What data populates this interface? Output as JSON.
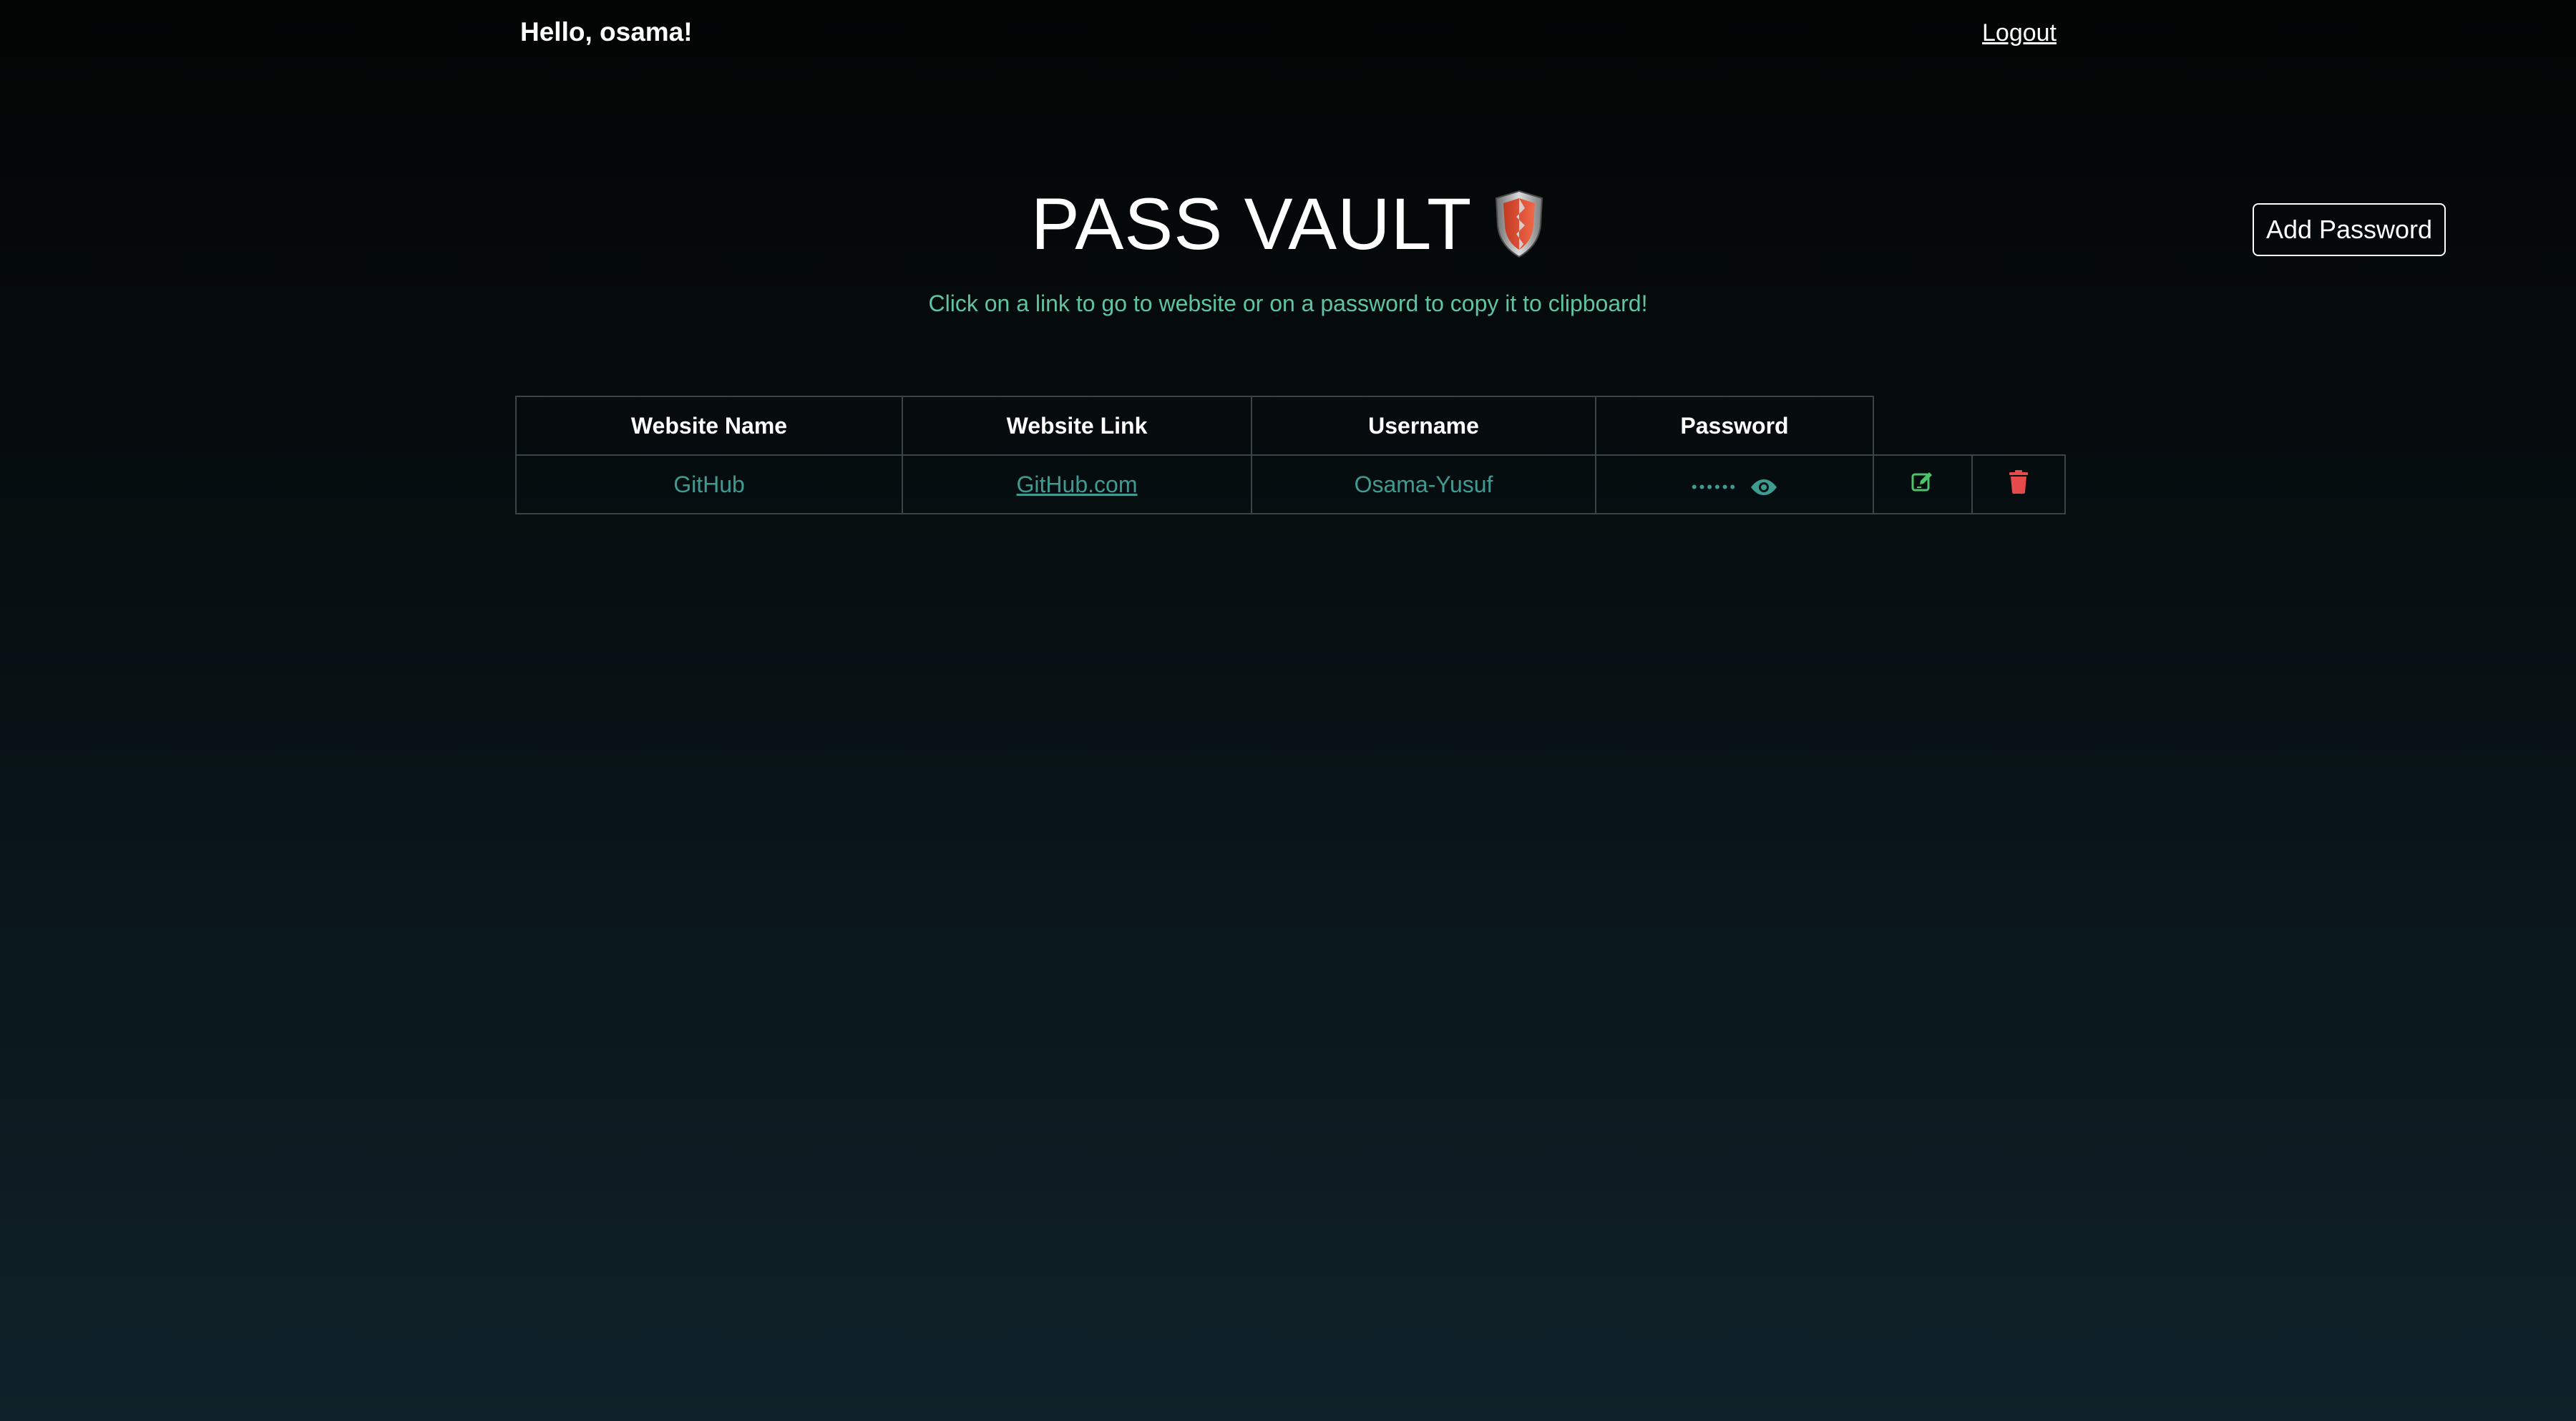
{
  "header": {
    "greeting": "Hello, osama!",
    "logout_label": "Logout"
  },
  "hero": {
    "title": "PASS VAULT",
    "subtitle": "Click on a link to go to website or on a password to copy it to clipboard!"
  },
  "actions": {
    "add_password_label": "Add Password"
  },
  "table": {
    "columns": [
      "Website Name",
      "Website Link",
      "Username",
      "Password"
    ],
    "rows": [
      {
        "website_name": "GitHub",
        "website_link": "GitHub.com",
        "username": "Osama-Yusuf",
        "password_masked": "••••••"
      }
    ]
  },
  "icons": {
    "shield": "shield-icon",
    "reveal": "eye-icon",
    "edit": "edit-icon",
    "delete": "trash-icon"
  },
  "colors": {
    "accent_text": "#3f9b8f",
    "subtitle": "#5fc4a5",
    "edit": "#4cc46a",
    "delete": "#e54b4b",
    "border": "#3a4548"
  }
}
